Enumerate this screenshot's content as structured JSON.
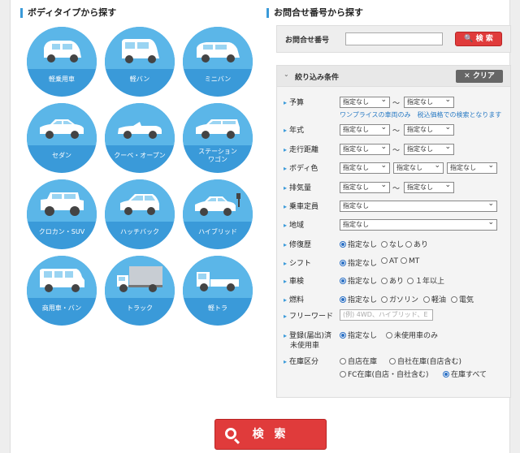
{
  "body_type": {
    "title": "ボディタイプから探す",
    "items": [
      {
        "label": "軽乗用車",
        "icon": "kei-car-icon"
      },
      {
        "label": "軽バン",
        "icon": "kei-van-icon"
      },
      {
        "label": "ミニバン",
        "icon": "minivan-icon"
      },
      {
        "label": "セダン",
        "icon": "sedan-icon"
      },
      {
        "label": "クーペ・オープン",
        "icon": "convertible-icon"
      },
      {
        "label": "ステーション",
        "label2": "ワゴン",
        "icon": "wagon-icon"
      },
      {
        "label": "クロカン・SUV",
        "icon": "suv-icon"
      },
      {
        "label": "ハッチバック",
        "icon": "hatchback-icon"
      },
      {
        "label": "ハイブリッド",
        "icon": "hybrid-icon"
      },
      {
        "label": "商用車・バン",
        "icon": "van-icon"
      },
      {
        "label": "トラック",
        "icon": "truck-icon"
      },
      {
        "label": "軽トラ",
        "icon": "kei-truck-icon"
      }
    ]
  },
  "inquiry": {
    "title": "お問合せ番号から探す",
    "label": "お問合せ番号",
    "value": "",
    "button": "検 索"
  },
  "filter": {
    "title": "絞り込み条件",
    "clear": "クリア",
    "tilde": "〜",
    "budget": {
      "label": "予算",
      "from": "指定なし",
      "to": "指定なし",
      "note": "ワンプライスの車両のみ　税込価格での検索となります"
    },
    "year": {
      "label": "年式",
      "from": "指定なし",
      "to": "指定なし"
    },
    "mileage": {
      "label": "走行距離",
      "from": "指定なし",
      "to": "指定なし"
    },
    "color": {
      "label": "ボディ色",
      "c1": "指定なし",
      "c2": "指定なし",
      "c3": "指定なし"
    },
    "displacement": {
      "label": "排気量",
      "from": "指定なし",
      "to": "指定なし"
    },
    "seats": {
      "label": "乗車定員",
      "value": "指定なし"
    },
    "region": {
      "label": "地域",
      "value": "指定なし"
    },
    "repair": {
      "label": "修復歴",
      "options": [
        "指定なし",
        "なし",
        "あり"
      ]
    },
    "shift": {
      "label": "シフト",
      "options": [
        "指定なし",
        "AT",
        "MT"
      ]
    },
    "inspection": {
      "label": "車検",
      "options": [
        "指定なし",
        "あり",
        "１年以上"
      ]
    },
    "fuel": {
      "label": "燃料",
      "options": [
        "指定なし",
        "ガソリン",
        "軽油",
        "電気"
      ]
    },
    "keyword": {
      "label": "フリーワード",
      "placeholder": "(例) 4WD、ハイブリッド、E"
    },
    "registration": {
      "label": "登録(届出)済",
      "label2": "未使用車",
      "options": [
        "指定なし",
        "未使用車のみ"
      ]
    },
    "stock": {
      "label": "在庫区分",
      "options": [
        "自店在庫",
        "自社在庫(自店含む)",
        "FC在庫(自店・自社含む)",
        "在庫すべて"
      ]
    }
  },
  "search_button": "検 索",
  "colors": {
    "accent": "#3a9ad9",
    "red": "#e03b3b"
  }
}
